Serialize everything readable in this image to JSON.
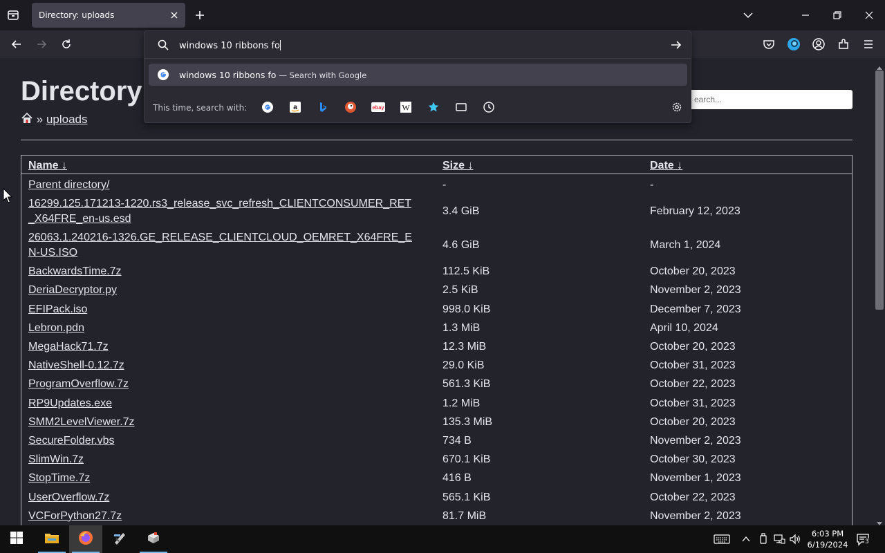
{
  "browser": {
    "tab_title": "Directory: uploads",
    "url_input_value": "windows 10 ribbons fo",
    "suggestion_text": "windows 10 ribbons fo",
    "suggestion_sub": "— Search with Google",
    "engines_label": "This time, search with:",
    "engines": [
      "google-icon",
      "amazon-icon",
      "bing-icon",
      "duckduckgo-icon",
      "ebay-icon",
      "wikipedia-icon",
      "bookmarks-icon",
      "tabs-icon",
      "history-icon"
    ]
  },
  "page": {
    "title": "Directory",
    "breadcrumb_sep": "»",
    "breadcrumb_current": "uploads",
    "search_placeholder": "earch...",
    "columns": {
      "name": "Name",
      "size": "Size",
      "date": "Date",
      "sort_arrow": "↓"
    },
    "rows": [
      {
        "name": "Parent directory/",
        "size": "-",
        "date": "-"
      },
      {
        "name": "16299.125.171213-1220.rs3_release_svc_refresh_CLIENTCONSUMER_RET_X64FRE_en-us.esd",
        "size": "3.4 GiB",
        "date": "February 12, 2023"
      },
      {
        "name": "26063.1.240216-1326.GE_RELEASE_CLIENTCLOUD_OEMRET_X64FRE_EN-US.ISO",
        "size": "4.6 GiB",
        "date": "March 1, 2024"
      },
      {
        "name": "BackwardsTime.7z",
        "size": "112.5 KiB",
        "date": "October 20, 2023"
      },
      {
        "name": "DeriaDecryptor.py",
        "size": "2.5 KiB",
        "date": "November 2, 2023"
      },
      {
        "name": "EFIPack.iso",
        "size": "998.0 KiB",
        "date": "December 7, 2023"
      },
      {
        "name": "Lebron.pdn",
        "size": "1.3 MiB",
        "date": "April 10, 2024"
      },
      {
        "name": "MegaHack71.7z",
        "size": "12.3 MiB",
        "date": "October 20, 2023"
      },
      {
        "name": "NativeShell-0.12.7z",
        "size": "29.0 KiB",
        "date": "October 31, 2023"
      },
      {
        "name": "ProgramOverflow.7z",
        "size": "561.3 KiB",
        "date": "October 22, 2023"
      },
      {
        "name": "RP9Updates.exe",
        "size": "1.2 MiB",
        "date": "October 31, 2023"
      },
      {
        "name": "SMM2LevelViewer.7z",
        "size": "135.3 MiB",
        "date": "October 20, 2023"
      },
      {
        "name": "SecureFolder.vbs",
        "size": "734 B",
        "date": "November 2, 2023"
      },
      {
        "name": "SlimWin.7z",
        "size": "670.1 KiB",
        "date": "October 30, 2023"
      },
      {
        "name": "StopTime.7z",
        "size": "416 B",
        "date": "November 1, 2023"
      },
      {
        "name": "UserOverflow.7z",
        "size": "565.1 KiB",
        "date": "October 22, 2023"
      },
      {
        "name": "VCForPython27.7z",
        "size": "81.7 MiB",
        "date": "November 2, 2023"
      }
    ]
  },
  "taskbar": {
    "time": "6:03 PM",
    "date": "6/19/2024",
    "notification_count": "3"
  },
  "colors": {
    "page_bg": "#22232b",
    "text": "#e3e5ea",
    "accent": "#76b9ed"
  }
}
